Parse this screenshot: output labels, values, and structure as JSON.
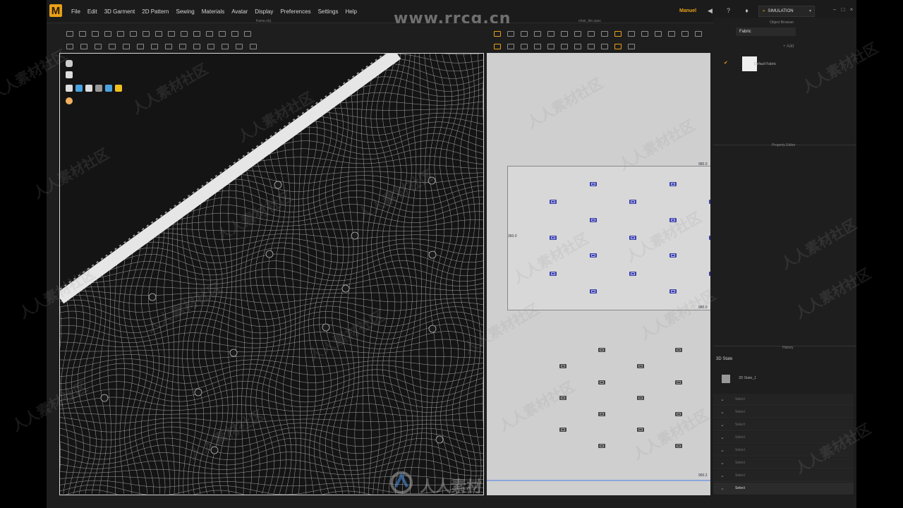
{
  "app": {
    "logo": "M",
    "user": "Manuel",
    "simulation_label": "SIMULATION",
    "watermark": "www.rrcg.cn"
  },
  "menu": [
    "File",
    "Edit",
    "3D Garment",
    "2D Pattern",
    "Sewing",
    "Materials",
    "Avatar",
    "Display",
    "Preferences",
    "Settings",
    "Help"
  ],
  "views": {
    "left_title": "frame.obj",
    "right_title": "chair_tile.zpac"
  },
  "pattern_2d": {
    "dim_top": "980.0",
    "dim_left": "360.0",
    "dim_bottom": "980.0",
    "dim_low": "960.2"
  },
  "right_panel": {
    "object_browser": "Object Browser",
    "fabric_tab": "Fabric",
    "add_label": "+ Add",
    "fabric_item": "Default Fabric",
    "property_editor": "Property Editor",
    "history": "History",
    "state_title": "3D State",
    "state_item": "3D State_1",
    "history_rows": [
      "Select",
      "Select",
      "Select",
      "Select",
      "Select",
      "Select",
      "Select",
      "Select"
    ]
  },
  "colors": {
    "accent": "#e8a019",
    "viewport_bg": "#141414",
    "pattern_bg": "#cfcfcf",
    "button_blue": "#3a3fa8"
  },
  "watermarks": {
    "repeating": "人人素材社区",
    "bottom_brand": "人人素材"
  }
}
